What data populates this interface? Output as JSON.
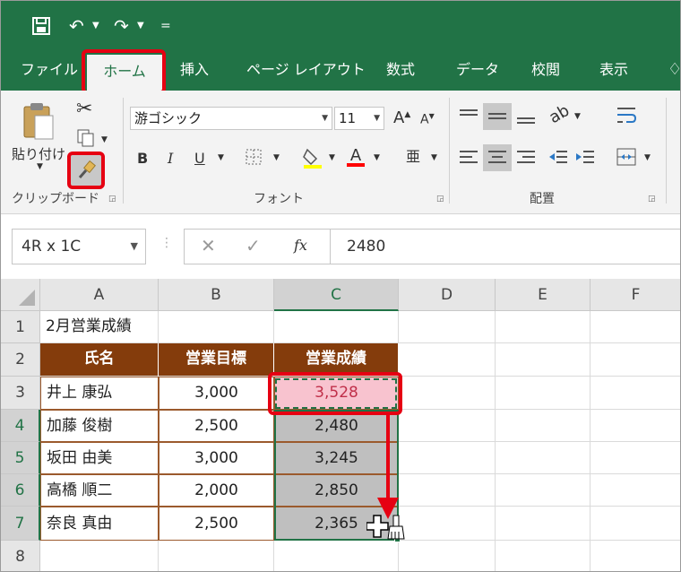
{
  "tabs": {
    "file": "ファイル",
    "home": "ホーム",
    "insert": "挿入",
    "page_layout": "ページ レイアウト",
    "formulas": "数式",
    "data": "データ",
    "review": "校閲",
    "view": "表示"
  },
  "ribbon": {
    "paste_label": "貼り付け",
    "clipboard_group": "クリップボード",
    "font_name": "游ゴシック",
    "font_size": "11",
    "font_group": "フォント",
    "alignment_group": "配置",
    "bold": "B",
    "italic": "I",
    "underline": "U"
  },
  "formula_bar": {
    "name_box": "4R x 1C",
    "fx": "fx",
    "value": "2480"
  },
  "sheet": {
    "columns": [
      "A",
      "B",
      "C",
      "D",
      "E",
      "F"
    ],
    "rows": [
      "1",
      "2",
      "3",
      "4",
      "5",
      "6",
      "7",
      "8"
    ],
    "title": "2月営業成績",
    "headers": [
      "氏名",
      "営業目標",
      "営業成績"
    ],
    "data": [
      [
        "井上 康弘",
        "3,000",
        "3,528"
      ],
      [
        "加藤 俊樹",
        "2,500",
        "2,480"
      ],
      [
        "坂田 由美",
        "3,000",
        "3,245"
      ],
      [
        "高橋 順二",
        "2,000",
        "2,850"
      ],
      [
        "奈良 真由",
        "2,500",
        "2,365"
      ]
    ]
  },
  "colors": {
    "excel_green": "#217346",
    "header_brown": "#843c0c",
    "highlight_pink": "#f8c3cf",
    "annotation_red": "#e60012"
  }
}
